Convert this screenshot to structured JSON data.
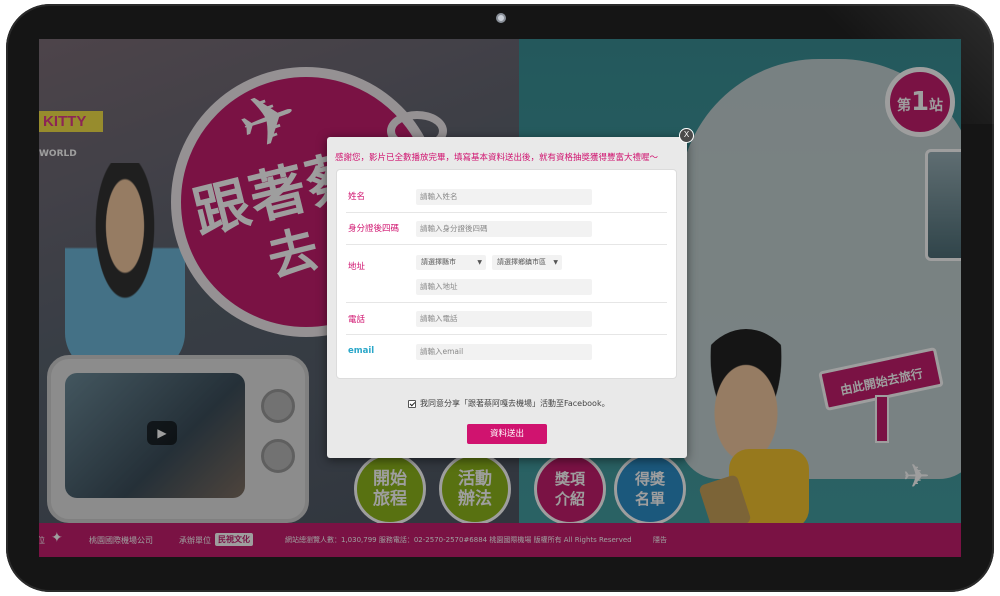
{
  "modal": {
    "close_label": "X",
    "title": "感謝您，影片已全數播放完畢，填寫基本資料送出後，就有資格抽獎獲得豐富大禮喔～",
    "fields": {
      "name": {
        "label": "姓名",
        "placeholder": "請輸入姓名"
      },
      "id4": {
        "label": "身分證後四碼",
        "placeholder": "請輸入身分證後四碼"
      },
      "address": {
        "label": "地址",
        "city_select": "請選擇縣市",
        "district_select": "請選擇鄉鎮市區",
        "placeholder": "請輸入地址"
      },
      "phone": {
        "label": "電話",
        "placeholder": "請輸入電話"
      },
      "email": {
        "label": "email",
        "placeholder": "請輸入email"
      }
    },
    "consent_text": "我同意分享「跟著蔡阿嘎去機場」活動至Facebook。",
    "submit_label": "資料送出"
  },
  "background": {
    "kitty_text": "KITTY",
    "kitty_sub": "WORLD",
    "logo_line1": "跟著蔡",
    "logo_line2": "去",
    "station_prefix": "第",
    "station_number": "1",
    "station_suffix": "站",
    "sign_text": "由此開始去旅行",
    "menu": [
      {
        "line1": "開始",
        "line2": "旅程"
      },
      {
        "line1": "活動",
        "line2": "辦法"
      },
      {
        "line1": "獎項",
        "line2": "介紹"
      },
      {
        "line1": "得獎",
        "line2": "名單"
      }
    ],
    "play_icon": "play-icon"
  },
  "footer": {
    "organizer_suffix": "位",
    "airport_name": "桃園國際機場公司",
    "sponsor_label": "承辦單位",
    "sponsor_logo": "民視文化",
    "visitor_info": "網站總瀏覽人數：1,030,799 服務電話：02-2570-2570#6884 桃園國際機場 版權所有 All Rights Reserved",
    "privacy": "隱告"
  },
  "colors": {
    "brand_magenta": "#c51e6e",
    "label_magenta": "#d0136f",
    "email_cyan": "#2aa7c9",
    "modal_bg": "#e9e9e9"
  }
}
